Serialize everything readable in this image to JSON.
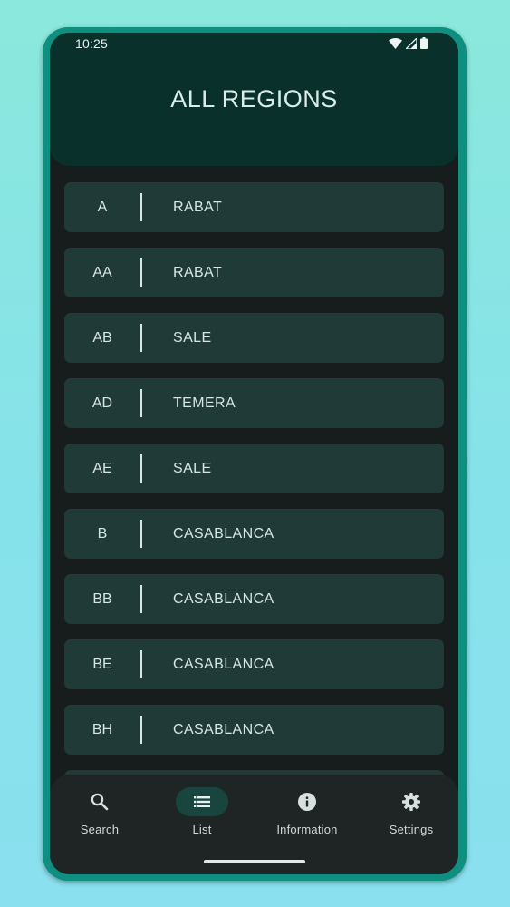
{
  "status_bar": {
    "time": "10:25"
  },
  "header": {
    "title": "ALL REGIONS"
  },
  "regions": [
    {
      "code": "A",
      "city": "RABAT"
    },
    {
      "code": "AA",
      "city": "RABAT"
    },
    {
      "code": "AB",
      "city": "SALE"
    },
    {
      "code": "AD",
      "city": "TEMERA"
    },
    {
      "code": "AE",
      "city": "SALE"
    },
    {
      "code": "B",
      "city": "CASABLANCA"
    },
    {
      "code": "BB",
      "city": "CASABLANCA"
    },
    {
      "code": "BE",
      "city": "CASABLANCA"
    },
    {
      "code": "BH",
      "city": "CASABLANCA"
    }
  ],
  "bottom_nav": {
    "items": [
      {
        "label": "Search",
        "icon": "search-icon",
        "active": false
      },
      {
        "label": "List",
        "icon": "list-icon",
        "active": true
      },
      {
        "label": "Information",
        "icon": "info-icon",
        "active": false
      },
      {
        "label": "Settings",
        "icon": "gear-icon",
        "active": false
      }
    ]
  },
  "colors": {
    "background": "#8ae4e4",
    "frame": "#0f8f7f",
    "header": "#0a302c",
    "row": "#203a38",
    "active_pill": "#18463f"
  }
}
